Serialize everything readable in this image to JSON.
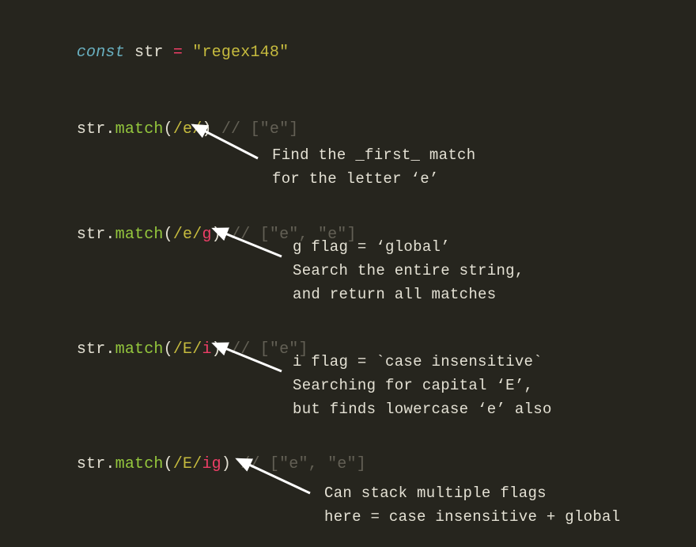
{
  "declaration": {
    "keyword": "const",
    "identifier": "str",
    "operator": "=",
    "value": "\"regex148\""
  },
  "examples": [
    {
      "object": "str",
      "method": "match",
      "regex_body": "/e/",
      "regex_flags": "",
      "comment": "// [\"e\"]",
      "annotation": "Find the _first_ match\nfor the letter ‘e’"
    },
    {
      "object": "str",
      "method": "match",
      "regex_body": "/e/",
      "regex_flags": "g",
      "comment": "// [\"e\", \"e\"]",
      "annotation": "g flag = ‘global’\nSearch the entire string,\nand return all matches"
    },
    {
      "object": "str",
      "method": "match",
      "regex_body": "/E/",
      "regex_flags": "i",
      "comment": "// [\"e\"]",
      "annotation": "i flag = `case insensitive`\nSearching for capital ‘E’,\nbut finds lowercase ‘e’ also"
    },
    {
      "object": "str",
      "method": "match",
      "regex_body": "/E/",
      "regex_flags": "ig",
      "comment": "// [\"e\", \"e\"]",
      "annotation": "Can stack multiple flags\nhere = case insensitive + global"
    }
  ]
}
